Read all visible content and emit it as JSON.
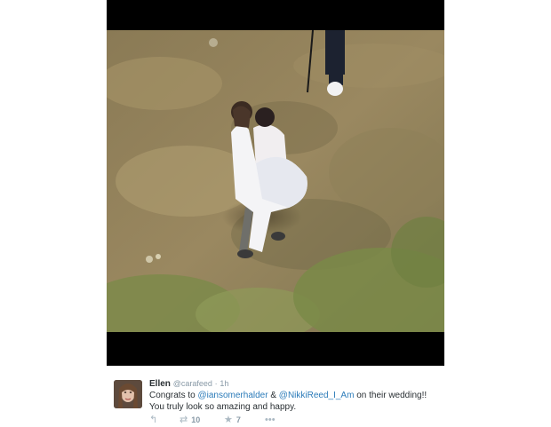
{
  "tweet": {
    "author_name": "Ellen",
    "author_handle": "@carafeed",
    "separator": "·",
    "timestamp": "1h",
    "text_part1": "Congrats to ",
    "mention1": "@iansomerhalder",
    "text_part2": " & ",
    "mention2": "@NikkiReed_I_Am",
    "text_part3": " on their wedding!! You truly look so amazing and happy.",
    "retweet_count": "10",
    "favorite_count": "7"
  },
  "icons": {
    "reply": "reply-icon",
    "retweet": "retweet-icon",
    "favorite": "star-icon",
    "more": "more-icon"
  },
  "colors": {
    "link": "#2b7bb9",
    "text": "#292f33",
    "muted": "#8899a6"
  }
}
